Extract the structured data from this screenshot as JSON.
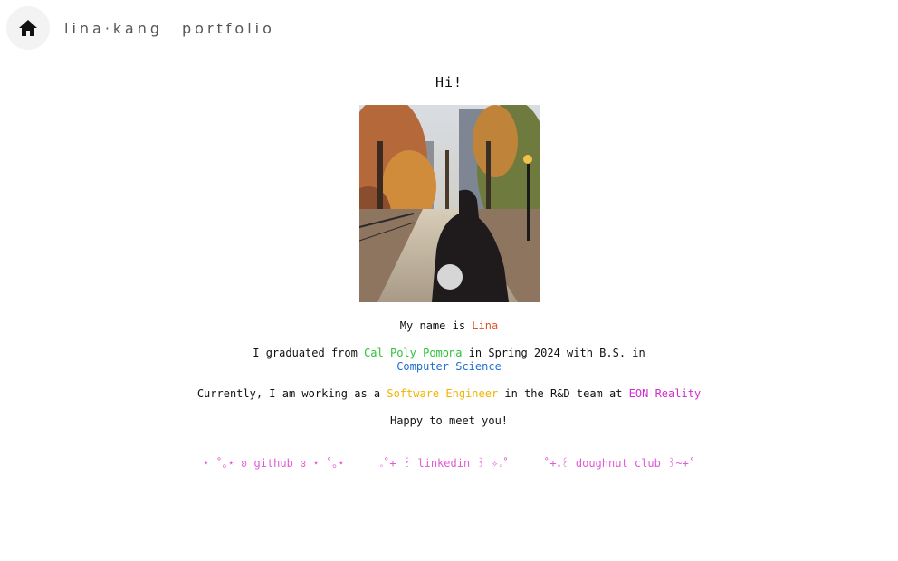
{
  "nav": {
    "home_icon": "home-icon",
    "name_link": "lina·kang",
    "portfolio_link": "portfolio"
  },
  "main": {
    "greeting": "Hi!",
    "photo_alt": "Photo",
    "intro": {
      "prefix": "My name is ",
      "name": "Lina"
    },
    "education": {
      "prefix": "I graduated from ",
      "school": "Cal Poly Pomona",
      "middle": " in Spring 2024 with B.S. in",
      "major": "Computer Science"
    },
    "work": {
      "prefix": "Currently, I am working as a ",
      "role": "Software Engineer",
      "middle": " in the R&D team at ",
      "company": "EON Reality"
    },
    "closing": "Happy to meet you!"
  },
  "socials": {
    "github": "⋆ ˚｡⋆ ʚ github ɞ ⋆ ˚｡⋆",
    "linkedin": "｡˚+ ꒰ linkedin ꒱ ✧｡˚",
    "doughnut": "˚+｡꒰ doughnut club ꒱~+˚"
  },
  "colors": {
    "name": "#e0532b",
    "school": "#2ec23a",
    "major": "#1f6fd1",
    "role": "#f0b400",
    "company": "#d22ccf",
    "socials": "#e05ad6"
  }
}
